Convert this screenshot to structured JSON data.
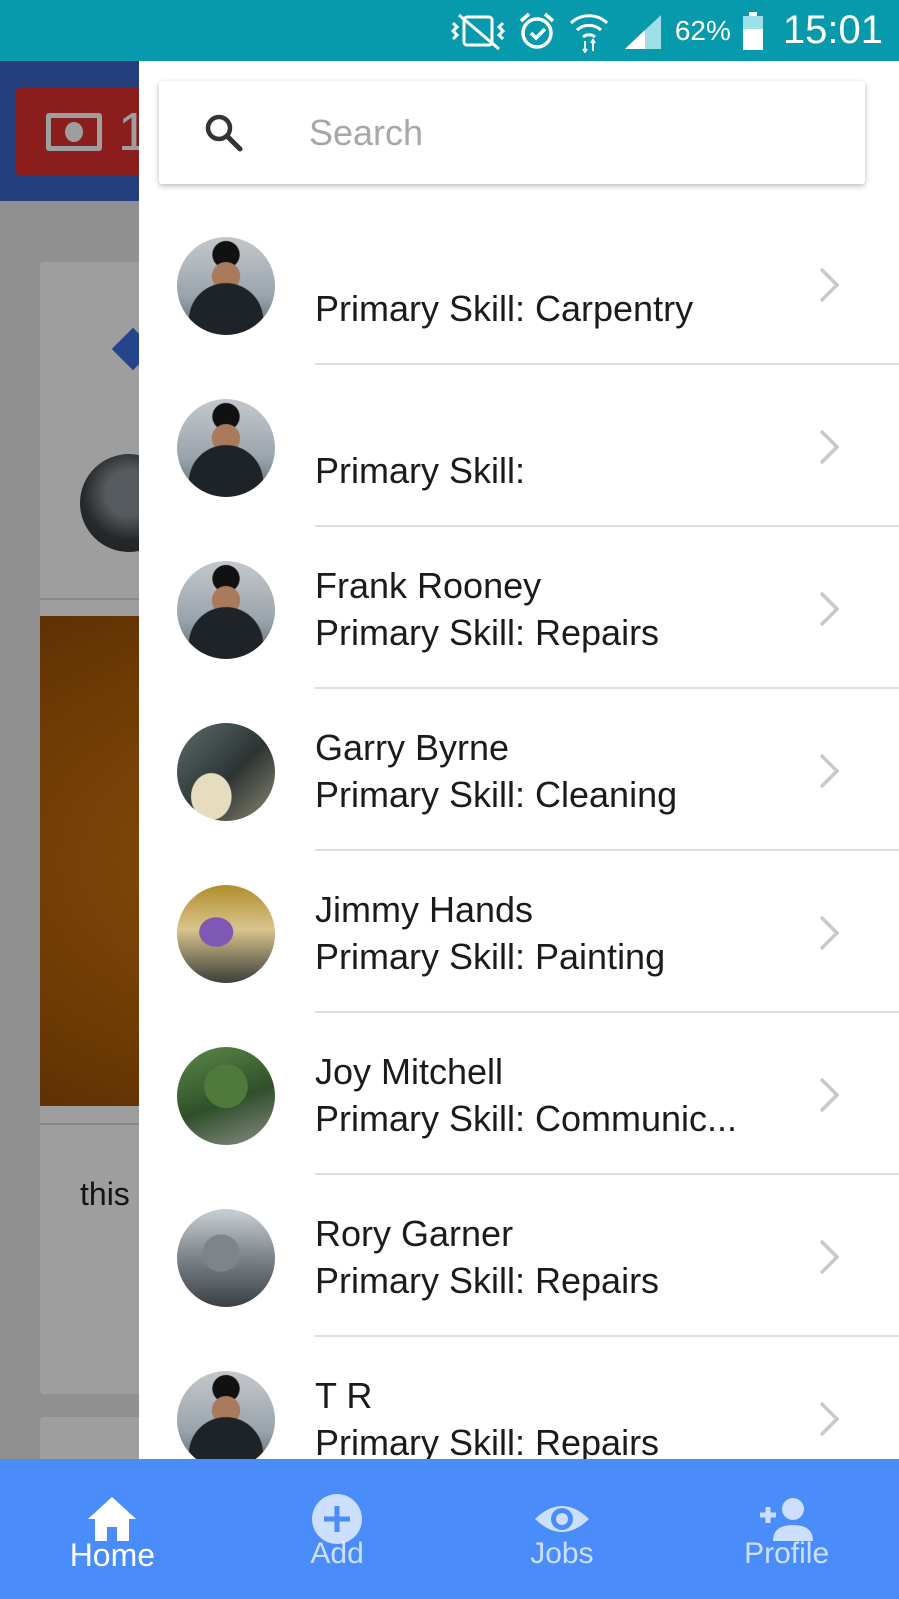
{
  "status_bar": {
    "battery_percent": "62%",
    "time": "15:01",
    "icons": [
      "vibrate-icon",
      "alarm-icon",
      "wifi-icon",
      "signal-icon",
      "battery-icon"
    ]
  },
  "background_screen": {
    "chip_text": "1",
    "card_text": "this"
  },
  "search": {
    "placeholder": "Search"
  },
  "contacts": [
    {
      "name": "",
      "skill": "Primary Skill: Carpentry",
      "avatar": "gent"
    },
    {
      "name": "",
      "skill": "Primary Skill:",
      "avatar": "gent"
    },
    {
      "name": "Frank Rooney",
      "skill": "Primary Skill: Repairs",
      "avatar": "gent"
    },
    {
      "name": "Garry Byrne",
      "skill": "Primary Skill: Cleaning",
      "avatar": "desk"
    },
    {
      "name": "Jimmy Hands",
      "skill": "Primary Skill: Painting",
      "avatar": "office"
    },
    {
      "name": "Joy Mitchell",
      "skill": "Primary Skill: Communic...",
      "avatar": "plant"
    },
    {
      "name": "Rory Garner",
      "skill": "Primary Skill: Repairs",
      "avatar": "car"
    },
    {
      "name": "T R",
      "skill": "Primary Skill: Repairs",
      "avatar": "gent"
    }
  ],
  "bottom_nav": {
    "tabs": [
      {
        "label": "Home",
        "icon": "home-icon",
        "active": true
      },
      {
        "label": "Add",
        "icon": "add-circle-icon",
        "active": false
      },
      {
        "label": "Jobs",
        "icon": "eye-icon",
        "active": false
      },
      {
        "label": "Profile",
        "icon": "person-add-icon",
        "active": false
      }
    ]
  },
  "colors": {
    "status_bar": "#0799ac",
    "bottom_nav": "#4a8cfa",
    "header": "#3a66c7",
    "chip": "#e0312f"
  }
}
